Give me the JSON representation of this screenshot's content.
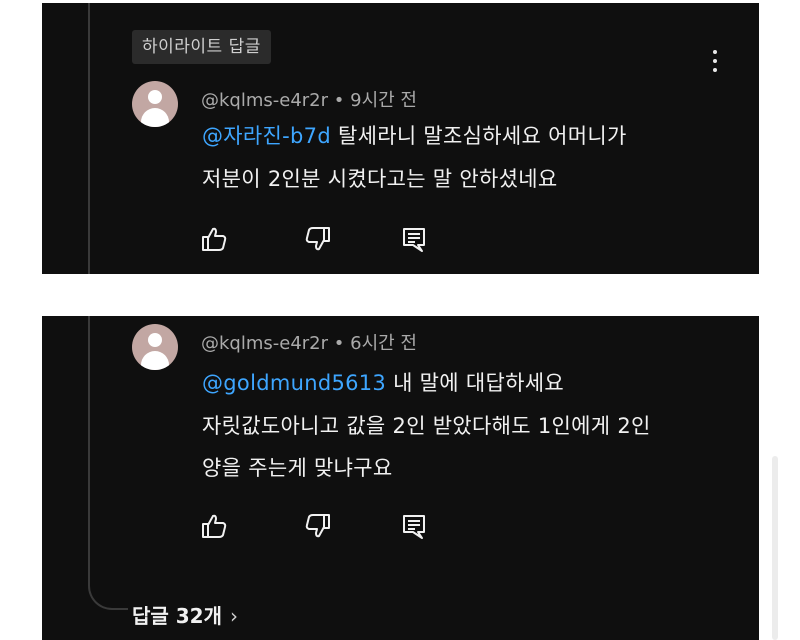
{
  "highlight_badge": "하이라이트 답글",
  "comments": [
    {
      "author": "@kqlms-e4r2r",
      "time": "9시간 전",
      "mention": "@자라진-b7d",
      "line1_rest": "탈세라니 말조심하세요 어머니가",
      "line2": "저분이 2인분 시켰다고는 말 안하셨네요"
    },
    {
      "author": "@kqlms-e4r2r",
      "time": "6시간 전",
      "mention": "@goldmund5613",
      "line1_rest": "내 말에 대답하세요",
      "line2": "자릿값도아니고 값을 2인 받았다해도 1인에게 2인",
      "line3": "양을 주는게 맞냐구요"
    }
  ],
  "separator": "•",
  "replies_label": "답글 32개",
  "chevron": "›",
  "icons": [
    "thumbs-up-icon",
    "thumbs-down-icon",
    "reply-icon",
    "more-vert-icon",
    "avatar-person-icon"
  ],
  "colors": {
    "background": "#0f0f0f",
    "text": "#f1f1f1",
    "meta": "#aaaaaa",
    "mention": "#3ea6ff",
    "avatar": "#c2a7a3"
  }
}
